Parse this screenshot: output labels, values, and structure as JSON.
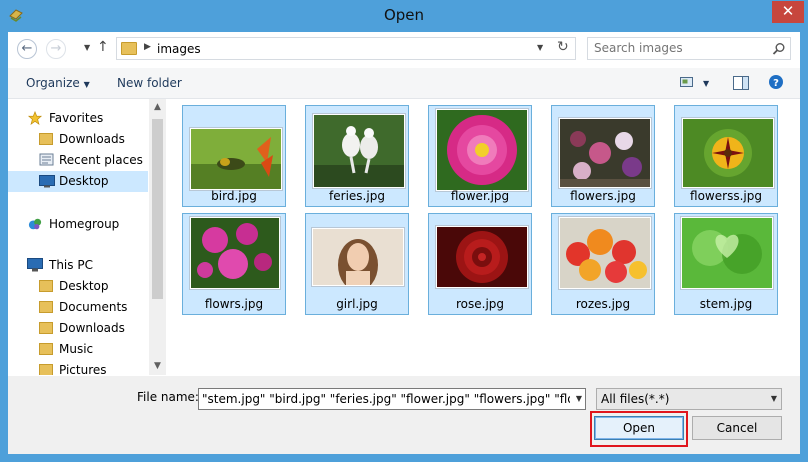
{
  "window": {
    "title": "Open",
    "close_glyph": "✕",
    "accent": "#4ea0da"
  },
  "address": {
    "folder": "images",
    "search_placeholder": "Search images"
  },
  "toolbar": {
    "organize": "Organize",
    "new_folder": "New folder"
  },
  "nav": {
    "items": [
      {
        "label": "Favorites",
        "icon": "star-icon"
      },
      {
        "label": "Downloads",
        "icon": "folder-icon"
      },
      {
        "label": "Recent places",
        "icon": "recent-icon"
      },
      {
        "label": "Desktop",
        "icon": "desktop-icon"
      },
      {
        "label": "Homegroup",
        "icon": "homegroup-icon"
      },
      {
        "label": "This PC",
        "icon": "pc-icon"
      },
      {
        "label": "Desktop",
        "icon": "folder-icon"
      },
      {
        "label": "Documents",
        "icon": "folder-icon"
      },
      {
        "label": "Downloads",
        "icon": "folder-icon"
      },
      {
        "label": "Music",
        "icon": "folder-icon"
      },
      {
        "label": "Pictures",
        "icon": "folder-icon"
      }
    ],
    "selected": "Desktop"
  },
  "files": [
    {
      "name": "bird.jpg"
    },
    {
      "name": "feries.jpg"
    },
    {
      "name": "flower.jpg"
    },
    {
      "name": "flowers.jpg"
    },
    {
      "name": "flowerss.jpg"
    },
    {
      "name": "flowrs.jpg"
    },
    {
      "name": "girl.jpg"
    },
    {
      "name": "rose.jpg"
    },
    {
      "name": "rozes.jpg"
    },
    {
      "name": "stem.jpg"
    }
  ],
  "bottom": {
    "file_name_label": "File name:",
    "file_name_value": "\"stem.jpg\" \"bird.jpg\" \"feries.jpg\" \"flower.jpg\" \"flowers.jpg\" \"flowerss.",
    "file_type": "All files(*.*)",
    "open_label": "Open",
    "cancel_label": "Cancel"
  }
}
